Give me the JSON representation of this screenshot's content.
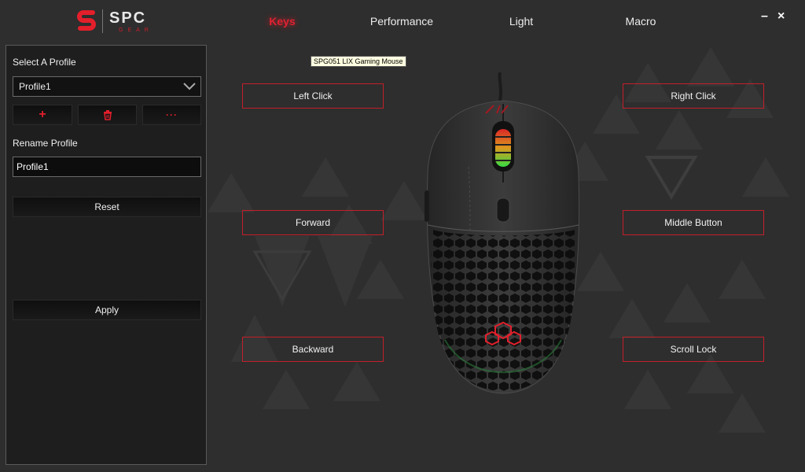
{
  "app": {
    "logo": {
      "main": "SPC",
      "sub": "GEAR"
    },
    "accent_color": "#e02131",
    "window_controls": {
      "minimize": "–",
      "close": "×"
    }
  },
  "nav": {
    "tabs": [
      {
        "label": "Keys",
        "active": true
      },
      {
        "label": "Performance",
        "active": false
      },
      {
        "label": "Light",
        "active": false
      },
      {
        "label": "Macro",
        "active": false
      }
    ]
  },
  "profile": {
    "select_label": "Select A Profile",
    "selected": "Profile1",
    "add_icon": "plus-icon",
    "delete_icon": "trash-icon",
    "more_icon": "more-icon",
    "rename_label": "Rename Profile",
    "rename_value": "Profile1",
    "reset_label": "Reset",
    "apply_label": "Apply"
  },
  "device": {
    "tooltip": "SPG051 LIX Gaming Mouse"
  },
  "buttons": {
    "left_click": "Left Click",
    "right_click": "Right Click",
    "forward": "Forward",
    "middle": "Middle Button",
    "backward": "Backward",
    "scroll_lock": "Scroll Lock"
  }
}
